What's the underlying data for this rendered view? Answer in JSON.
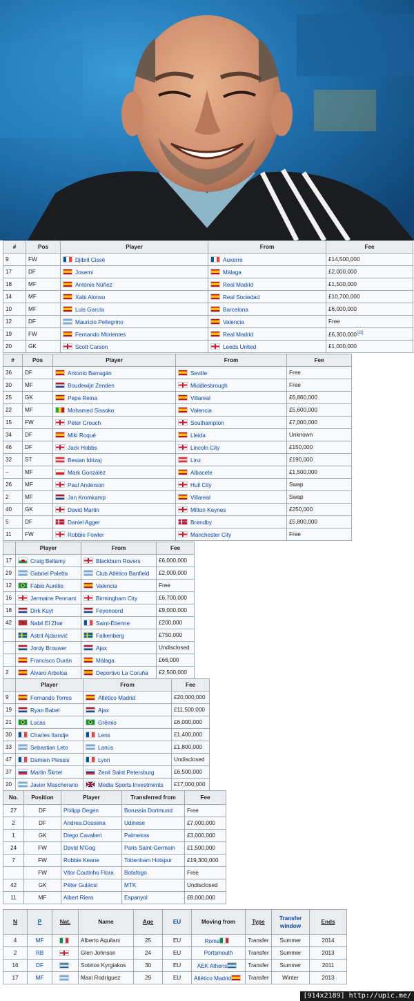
{
  "t1": {
    "headers": [
      "#",
      "Pos",
      "Player",
      "From",
      "Fee"
    ],
    "rows": [
      {
        "num": "9",
        "pos": "FW",
        "flag": "fr",
        "player": "Djibril Cissé",
        "fromflag": "fr",
        "from": "Auxerre",
        "fee": "£14,500,000",
        "ref": ""
      },
      {
        "num": "17",
        "pos": "DF",
        "flag": "es",
        "player": "Josemi",
        "fromflag": "es",
        "from": "Málaga",
        "fee": "£2,000,000",
        "ref": ""
      },
      {
        "num": "18",
        "pos": "MF",
        "flag": "es",
        "player": "Antonio Núñez",
        "fromflag": "es",
        "from": "Real Madrid",
        "fee": "£1,500,000",
        "ref": ""
      },
      {
        "num": "14",
        "pos": "MF",
        "flag": "es",
        "player": "Xabi Alonso",
        "fromflag": "es",
        "from": "Real Sociedad",
        "fee": "£10,700,000",
        "ref": ""
      },
      {
        "num": "10",
        "pos": "MF",
        "flag": "es",
        "player": "Luis García",
        "fromflag": "es",
        "from": "Barcelona",
        "fee": "£6,000,000",
        "ref": ""
      },
      {
        "num": "12",
        "pos": "DF",
        "flag": "ar",
        "player": "Mauricio Pellegrino",
        "fromflag": "es",
        "from": "Valencia",
        "fee": "Free",
        "ref": ""
      },
      {
        "num": "19",
        "pos": "FW",
        "flag": "es",
        "player": "Fernando Morientes",
        "fromflag": "es",
        "from": "Real Madrid",
        "fee": "£6,300,000",
        "ref": "[11]"
      },
      {
        "num": "20",
        "pos": "GK",
        "flag": "en",
        "player": "Scott Carson",
        "fromflag": "en",
        "from": "Leeds United",
        "fee": "£1,000,000",
        "ref": ""
      }
    ]
  },
  "t2": {
    "headers": [
      "#",
      "Pos",
      "Player",
      "From",
      "Fee"
    ],
    "rows": [
      {
        "num": "36",
        "pos": "DF",
        "flag": "es",
        "player": "Antonio Barragán",
        "fromflag": "es",
        "from": "Seville",
        "fee": "Free"
      },
      {
        "num": "30",
        "pos": "MF",
        "flag": "nl",
        "player": "Boudewijn Zenden",
        "fromflag": "en",
        "from": "Middlesbrough",
        "fee": "Free"
      },
      {
        "num": "25",
        "pos": "GK",
        "flag": "es",
        "player": "Pepe Reina",
        "fromflag": "es",
        "from": "Villareal",
        "fee": "£6,860,000"
      },
      {
        "num": "22",
        "pos": "MF",
        "flag": "ml",
        "player": "Mohamed Sissoko",
        "fromflag": "es",
        "from": "Valencia",
        "fee": "£5,600,000"
      },
      {
        "num": "15",
        "pos": "FW",
        "flag": "en",
        "player": "Peter Crouch",
        "fromflag": "en",
        "from": "Southampton",
        "fee": "£7,000,000"
      },
      {
        "num": "34",
        "pos": "DF",
        "flag": "es",
        "player": "Miki Roqué",
        "fromflag": "es",
        "from": "Lleida",
        "fee": "Unknown"
      },
      {
        "num": "46",
        "pos": "DF",
        "flag": "en",
        "player": "Jack Hobbs",
        "fromflag": "en",
        "from": "Lincoln City",
        "fee": "£150,000"
      },
      {
        "num": "32",
        "pos": "ST",
        "flag": "at",
        "player": "Besian Idrizaj",
        "fromflag": "at",
        "from": "Linz",
        "fee": "£190,000"
      },
      {
        "num": "–",
        "pos": "MF",
        "flag": "cl",
        "player": "Mark González",
        "fromflag": "es",
        "from": "Albacete",
        "fee": "£1,500,000"
      },
      {
        "num": "26",
        "pos": "MF",
        "flag": "en",
        "player": "Paul Anderson",
        "fromflag": "en",
        "from": "Hull City",
        "fee": "Swap"
      },
      {
        "num": "2",
        "pos": "MF",
        "flag": "nl",
        "player": "Jan Kromkamp",
        "fromflag": "es",
        "from": "Villareal",
        "fee": "Swap"
      },
      {
        "num": "40",
        "pos": "GK",
        "flag": "en",
        "player": "David Martin",
        "fromflag": "en",
        "from": "Milton Keynes",
        "fee": "£250,000"
      },
      {
        "num": "5",
        "pos": "DF",
        "flag": "dk",
        "player": "Daniel Agger",
        "fromflag": "dk",
        "from": "Brøndby",
        "fee": "£5,800,000"
      },
      {
        "num": "11",
        "pos": "FW",
        "flag": "en",
        "player": "Robbie Fowler",
        "fromflag": "en",
        "from": "Manchester City",
        "fee": "Free"
      }
    ]
  },
  "t3": {
    "headers": [
      "",
      "Player",
      "From",
      "Fee"
    ],
    "rows": [
      {
        "num": "17",
        "flag": "wa",
        "player": "Craig Bellamy",
        "fromflag": "en",
        "from": "Blackburn Rovers",
        "fee": "£6,000,000"
      },
      {
        "num": "29",
        "flag": "ar",
        "player": "Gabriel Paletta",
        "fromflag": "ar",
        "from": "Club Atlético Banfield",
        "fee": "£2,000,000"
      },
      {
        "num": "12",
        "flag": "br",
        "player": "Fábio Aurélio",
        "fromflag": "es",
        "from": "Valencia",
        "fee": "Free"
      },
      {
        "num": "16",
        "flag": "en",
        "player": "Jermaine Pennant",
        "fromflag": "en",
        "from": "Birmingham City",
        "fee": "£6,700,000"
      },
      {
        "num": "18",
        "flag": "nl",
        "player": "Dirk Kuyt",
        "fromflag": "nl",
        "from": "Feyenoord",
        "fee": "£9,000,000"
      },
      {
        "num": "42",
        "flag": "ma",
        "player": "Nabil El Zhar",
        "fromflag": "fr",
        "from": "Saint-Étienne",
        "fee": "£200,000"
      },
      {
        "num": "",
        "flag": "se",
        "player": "Astrit Ajdarević",
        "fromflag": "se",
        "from": "Falkenberg",
        "fee": "£750,000"
      },
      {
        "num": "",
        "flag": "nl",
        "player": "Jordy Brouwer",
        "fromflag": "nl",
        "from": "Ajax",
        "fee": "Undisclosed"
      },
      {
        "num": "",
        "flag": "es",
        "player": "Francisco Durán",
        "fromflag": "es",
        "from": "Málaga",
        "fee": "£66,000"
      },
      {
        "num": "2",
        "flag": "es",
        "player": "Álvaro Arbeloa",
        "fromflag": "es",
        "from": "Deportivo La Coruña",
        "fee": "£2,500,000"
      }
    ]
  },
  "t4": {
    "headers": [
      "",
      "Player",
      "From",
      "Fee"
    ],
    "rows": [
      {
        "num": "9",
        "flag": "es",
        "player": "Fernando Torres",
        "fromflag": "es",
        "from": "Atlético Madrid",
        "fee": "£20,000,000"
      },
      {
        "num": "19",
        "flag": "nl",
        "player": "Ryan Babel",
        "fromflag": "nl",
        "from": "Ajax",
        "fee": "£11,500,000"
      },
      {
        "num": "21",
        "flag": "br",
        "player": "Lucas",
        "fromflag": "br",
        "from": "Grêmio",
        "fee": "£6,000,000"
      },
      {
        "num": "30",
        "flag": "fr",
        "player": "Charles Itandje",
        "fromflag": "fr",
        "from": "Lens",
        "fee": "£1,400,000"
      },
      {
        "num": "33",
        "flag": "ar",
        "player": "Sebastian Leto",
        "fromflag": "ar",
        "from": "Lanús",
        "fee": "£1,800,000"
      },
      {
        "num": "47",
        "flag": "fr",
        "player": "Damien Plessis",
        "fromflag": "fr",
        "from": "Lyon",
        "fee": "Undisclosed"
      },
      {
        "num": "37",
        "flag": "sk",
        "player": "Martin Škrtel",
        "fromflag": "ru",
        "from": "Zenit Saint Petersburg",
        "fee": "£6,500,000"
      },
      {
        "num": "20",
        "flag": "ar",
        "player": "Javier Mascherano",
        "fromflag": "gb",
        "from": "Media Sports Investments",
        "fee": "£17,000,000"
      }
    ]
  },
  "t5": {
    "headers": [
      "No.",
      "Position",
      "Player",
      "Transferred from",
      "Fee"
    ],
    "rows": [
      {
        "num": "27",
        "pos": "DF",
        "player": "Philipp Degen",
        "from": "Borussia Dortmund",
        "fee": "Free"
      },
      {
        "num": "2",
        "pos": "DF",
        "player": "Andrea Dossena",
        "from": "Udinese",
        "fee": "£7,000,000"
      },
      {
        "num": "1",
        "pos": "GK",
        "player": "Diego Cavalieri",
        "from": "Palmeiras",
        "fee": "£3,000,000"
      },
      {
        "num": "24",
        "pos": "FW",
        "player": "David N'Gog",
        "from": "Paris Saint-Germain",
        "fee": "£1,500,000"
      },
      {
        "num": "7",
        "pos": "FW",
        "player": "Robbie Keane",
        "from": "Tottenham Hotspur",
        "fee": "£19,300,000"
      },
      {
        "num": "",
        "pos": "FW",
        "player": "Vitor Coutinho Flora",
        "from": "Botafogo",
        "fee": "Free"
      },
      {
        "num": "42",
        "pos": "GK",
        "player": "Péter Gulácsi",
        "from": "MTK",
        "fee": "Undisclosed"
      },
      {
        "num": "11",
        "pos": "MF",
        "player": "Albert Riera",
        "from": "Espanyol",
        "fee": "£8,000,000"
      }
    ]
  },
  "t6": {
    "headers": [
      "N",
      "P",
      "Nat.",
      "Name",
      "Age",
      "EU",
      "Moving from",
      "Type",
      "Transfer window",
      "Ends"
    ],
    "rows": [
      {
        "n": "4",
        "p": "MF",
        "flag": "it",
        "name": "Alberto Aquilani",
        "age": "25",
        "eu": "EU",
        "from": "Roma",
        "fromflag": "it",
        "type": "Transfer",
        "window": "Summer",
        "ends": "2014"
      },
      {
        "n": "2",
        "p": "RB",
        "flag": "en",
        "name": "Glen Johnson",
        "age": "24",
        "eu": "EU",
        "from": "Portsmouth",
        "fromflag": "",
        "type": "Transfer",
        "window": "Summer",
        "ends": "2013"
      },
      {
        "n": "16",
        "p": "DF",
        "flag": "gr",
        "name": "Sotirios Kyrgiakos",
        "age": "30",
        "eu": "EU",
        "from": "AEK Athens",
        "fromflag": "gr",
        "type": "Transfer",
        "window": "Summer",
        "ends": "2011"
      },
      {
        "n": "17",
        "p": "MF",
        "flag": "ar",
        "name": "Maxi Rodríguez",
        "age": "29",
        "eu": "EU",
        "from": "Atlético Madrid",
        "fromflag": "es",
        "type": "Transfer",
        "window": "Winter",
        "ends": "2013"
      }
    ]
  },
  "watermark": "[914x2189] http://upic.me/"
}
